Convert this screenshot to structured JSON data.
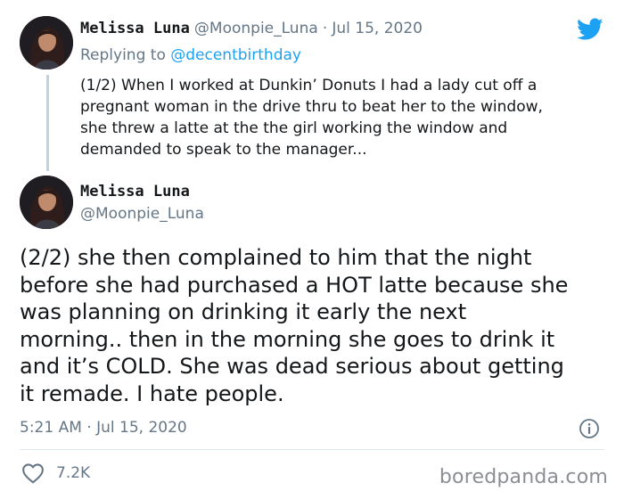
{
  "reply_tweet": {
    "author_name": "Melissa Luna",
    "author_handle": "@Moonpie_Luna",
    "separator": "·",
    "date": "Jul 15, 2020",
    "replying_prefix": "Replying to",
    "replying_to": "@decentbirthday",
    "lines": [
      "(1/2) When I worked at Dunkin’ Donuts I had a lady cut off a",
      "pregnant woman in the drive thru to beat her to the window,",
      "she threw a latte at the the girl working the window and",
      "demanded to speak to the manager..."
    ]
  },
  "main_tweet": {
    "author_name": "Melissa Luna",
    "author_handle": "@Moonpie_Luna",
    "lines": [
      "(2/2) she then complained to him that the night",
      "before she had purchased a HOT latte because she",
      "was planning on drinking it early the next",
      "morning.. then in the morning she goes to drink it",
      "and it’s COLD. She was dead serious about getting",
      "it remade. I hate people."
    ],
    "timestamp": "5:21 AM · Jul 15, 2020",
    "likes": "7.2K"
  },
  "watermark": "boredpanda.com",
  "icons": {
    "brand": "twitter-bird-icon",
    "info": "info-icon",
    "like": "heart-icon"
  },
  "colors": {
    "twitter_blue": "#1da1f2",
    "secondary_text": "#657786",
    "thread_line": "#c9d1d8"
  }
}
